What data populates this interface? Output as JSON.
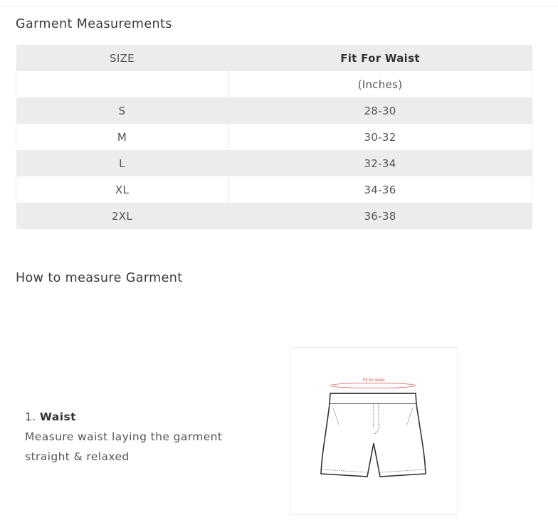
{
  "section1": {
    "title": "Garment Measurements"
  },
  "table": {
    "headers": [
      "SIZE",
      "Fit For Waist"
    ],
    "unit_row": [
      "",
      "(Inches)"
    ],
    "rows": [
      [
        "S",
        "28-30"
      ],
      [
        "M",
        "30-32"
      ],
      [
        "L",
        "32-34"
      ],
      [
        "XL",
        "34-36"
      ],
      [
        "2XL",
        "36-38"
      ]
    ]
  },
  "section2": {
    "title": "How to measure Garment"
  },
  "step": {
    "number": "1.",
    "name": "Waist",
    "description": "Measure waist laying the garment straight & relaxed"
  },
  "figure": {
    "label": "Fit for waist",
    "accent_color": "#d9534f",
    "icon": "shorts-diagram"
  }
}
